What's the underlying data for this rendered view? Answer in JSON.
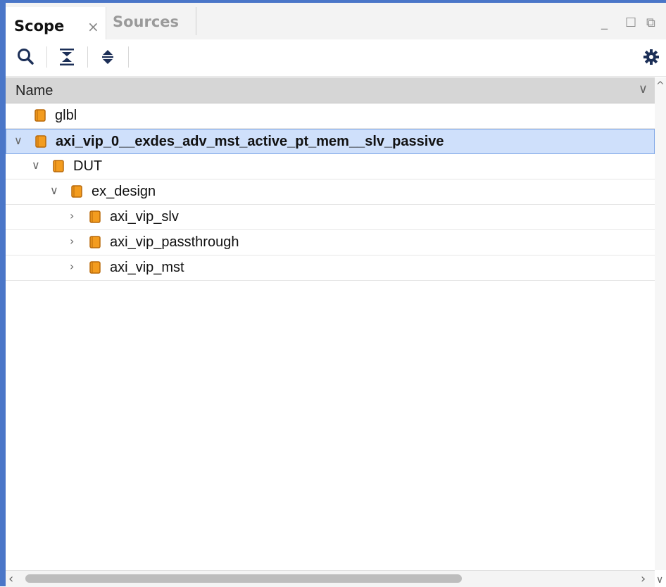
{
  "tabs": [
    {
      "label": "Scope",
      "active": true
    },
    {
      "label": "Sources",
      "active": false
    }
  ],
  "tab_close_glyph": "×",
  "window_controls": {
    "minimize": "_",
    "maximize": "☐",
    "float": "⧉"
  },
  "toolbar": {
    "icons": [
      "search-icon",
      "collapse-all-icon",
      "expand-all-icon",
      "settings-gear-icon"
    ]
  },
  "table": {
    "column_header": "Name"
  },
  "tree": [
    {
      "label": "glbl",
      "depth": 0,
      "expander": "",
      "bold": false,
      "selected": false
    },
    {
      "label": "axi_vip_0__exdes_adv_mst_active_pt_mem__slv_passive",
      "depth": 0,
      "expander": "∨",
      "bold": true,
      "selected": true
    },
    {
      "label": "DUT",
      "depth": 1,
      "expander": "∨",
      "bold": false,
      "selected": false
    },
    {
      "label": "ex_design",
      "depth": 2,
      "expander": "∨",
      "bold": false,
      "selected": false
    },
    {
      "label": "axi_vip_slv",
      "depth": 3,
      "expander": "›",
      "bold": false,
      "selected": false
    },
    {
      "label": "axi_vip_passthrough",
      "depth": 3,
      "expander": "›",
      "bold": false,
      "selected": false
    },
    {
      "label": "axi_vip_mst",
      "depth": 3,
      "expander": "›",
      "bold": false,
      "selected": false
    }
  ],
  "colors": {
    "accent_frame": "#4a76c8",
    "chip_fill": "#f39c1f",
    "chip_border": "#b8690a",
    "selection_bg": "#cfe0fb"
  }
}
